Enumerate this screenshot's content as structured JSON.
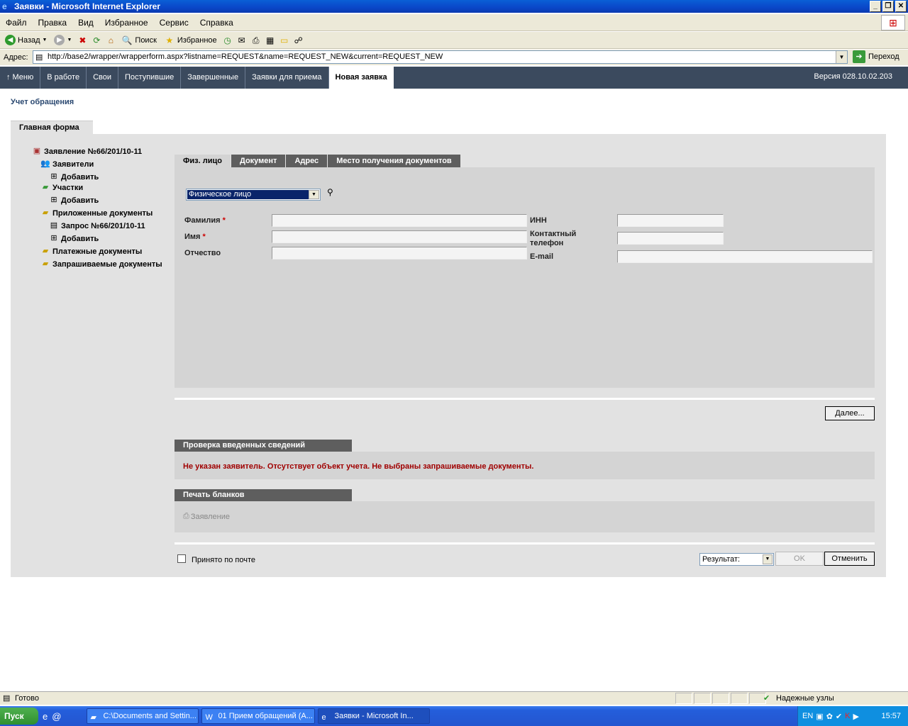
{
  "window": {
    "title": "Заявки - Microsoft Internet Explorer",
    "controls": [
      "_",
      "❐",
      "✕"
    ]
  },
  "menu": [
    "Файл",
    "Правка",
    "Вид",
    "Избранное",
    "Сервис",
    "Справка"
  ],
  "toolbar": {
    "back": "Назад",
    "search": "Поиск",
    "favorites": "Избранное"
  },
  "address": {
    "label": "Адрес:",
    "url": "http://base2/wrapper/wrapperform.aspx?listname=REQUEST&name=REQUEST_NEW&current=REQUEST_NEW",
    "go": "Переход"
  },
  "nav": {
    "items": [
      "Меню",
      "В работе",
      "Свои",
      "Поступившие",
      "Завершенные",
      "Заявки для приема",
      "Новая заявка"
    ],
    "version": "Версия 028.10.02.203"
  },
  "page": {
    "title": "Учет обращения",
    "main_tab": "Главная форма"
  },
  "tree": {
    "root": "Заявление №66/201/10-11",
    "applicants": "Заявители",
    "add1": "Добавить",
    "parcels": "Участки",
    "add2": "Добавить",
    "attached": "Приложенные документы",
    "request": "Запрос №66/201/10-11",
    "add3": "Добавить",
    "payments": "Платежные документы",
    "requested": "Запрашиваемые документы"
  },
  "subtabs": [
    "Физ. лицо",
    "Документ",
    "Адрес",
    "Место получения документов"
  ],
  "form": {
    "person_type": "Физическое лицо",
    "surname": "Фамилия",
    "name": "Имя",
    "patronymic": "Отчество",
    "inn": "ИНН",
    "phone_line1": "Контактный",
    "phone_line2": "телефон",
    "email": "E-mail",
    "required_mark": "*",
    "values": {
      "surname": "",
      "name": "",
      "patronymic": "",
      "inn": "",
      "phone": "",
      "email": ""
    }
  },
  "next_button": "Далее...",
  "check": {
    "title": "Проверка введенных сведений",
    "message": "Не указан заявитель. Отсутствует объект учета. Не выбраны запрашиваемые документы."
  },
  "print": {
    "title": "Печать бланков",
    "link": "Заявление"
  },
  "footer": {
    "mail_checkbox": "Принято по почте",
    "mail_checked": false,
    "result": "Результат:",
    "ok": "OK",
    "cancel": "Отменить"
  },
  "status": {
    "text": "Готово",
    "zone": "Надежные узлы"
  },
  "taskbar": {
    "start": "Пуск",
    "tasks": [
      "C:\\Documents and Settin...",
      "01 Прием обращений (А...",
      "Заявки - Microsoft In..."
    ],
    "lang": "EN",
    "clock": "15:57"
  }
}
